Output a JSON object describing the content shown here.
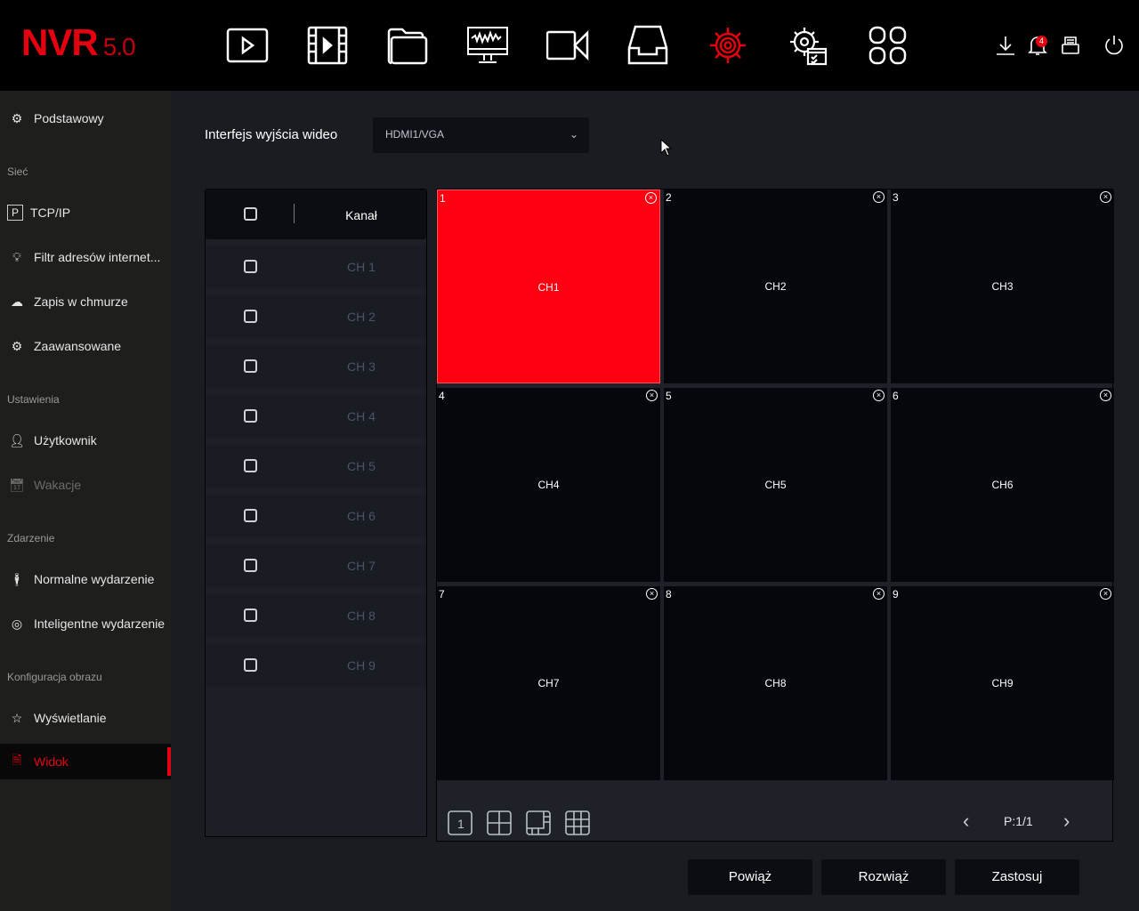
{
  "app": {
    "logo": "NVR",
    "version": "5.0",
    "accent": "#e5000f"
  },
  "topnav": [
    {
      "icon": "playback-icon"
    },
    {
      "icon": "video-film-icon"
    },
    {
      "icon": "folder-icon"
    },
    {
      "icon": "monitor-waveform-icon"
    },
    {
      "icon": "camera-icon"
    },
    {
      "icon": "inbox-tray-icon"
    },
    {
      "icon": "settings-gear-icon",
      "active": true
    },
    {
      "icon": "gear-checklist-icon"
    },
    {
      "icon": "apps-grid-icon"
    }
  ],
  "toolbar": {
    "download_icon": "download-icon",
    "bell_icon": "bell-icon",
    "notification_count": "4",
    "storage_icon": "storage-icon",
    "power_icon": "power-icon"
  },
  "sidebar": {
    "basic": "Podstawowy",
    "network_header": "Sieć",
    "tcpip": "TCP/IP",
    "filter": "Filtr adresów internet...",
    "cloud": "Zapis w chmurze",
    "advanced": "Zaawansowane",
    "settings_header": "Ustawienia",
    "user": "Użytkownik",
    "holidays": "Wakacje",
    "event_header": "Zdarzenie",
    "normal_event": "Normalne wydarzenie",
    "smart_event": "Inteligentne wydarzenie",
    "image_header": "Konfiguracja obrazu",
    "display": "Wyświetlanie",
    "view": "Widok"
  },
  "main": {
    "output_label": "Interfejs wyjścia wideo",
    "output_value": "HDMI1/VGA",
    "channel_header": "Kanał",
    "channels": [
      "CH 1",
      "CH 2",
      "CH 3",
      "CH 4",
      "CH 5",
      "CH 6",
      "CH 7",
      "CH 8",
      "CH 9"
    ],
    "cells": [
      {
        "num": "1",
        "name": "CH1",
        "selected": true
      },
      {
        "num": "2",
        "name": "CH2"
      },
      {
        "num": "3",
        "name": "CH3"
      },
      {
        "num": "4",
        "name": "CH4"
      },
      {
        "num": "5",
        "name": "CH5"
      },
      {
        "num": "6",
        "name": "CH6"
      },
      {
        "num": "7",
        "name": "CH7"
      },
      {
        "num": "8",
        "name": "CH8"
      },
      {
        "num": "9",
        "name": "CH9"
      }
    ],
    "layout_one": "1",
    "page": "P:1/1",
    "bind": "Powiąż",
    "unbind": "Rozwiąż",
    "apply": "Zastosuj"
  }
}
